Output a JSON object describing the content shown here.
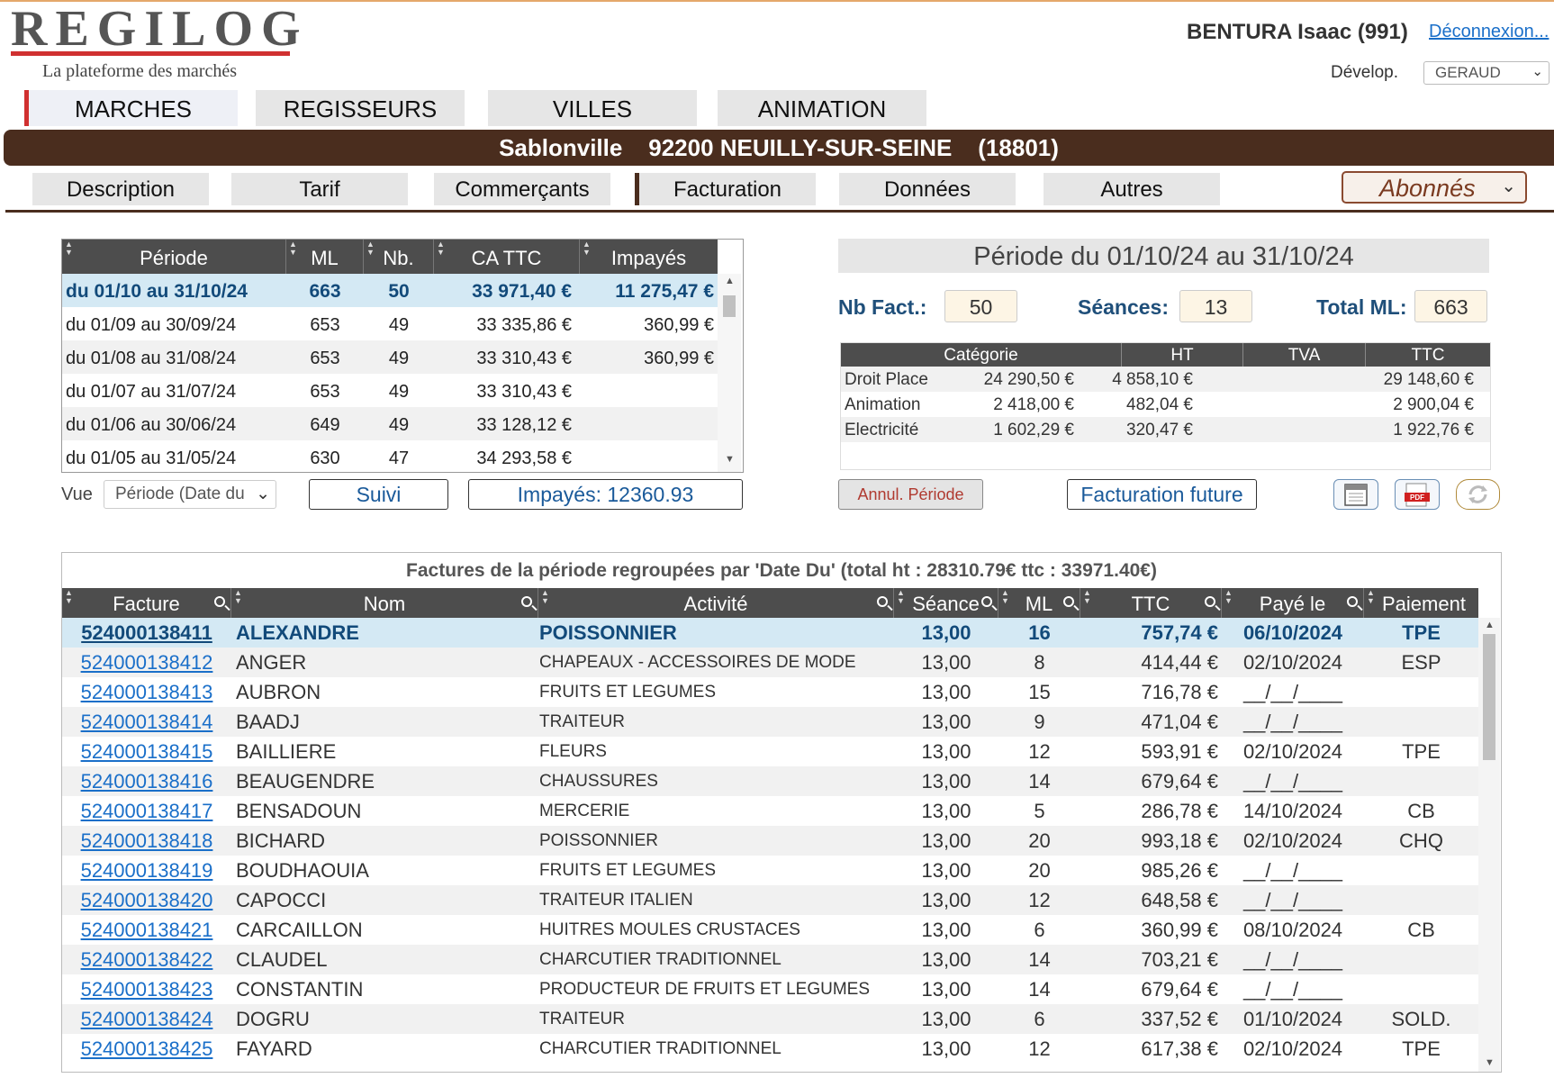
{
  "header": {
    "logo_text": "REGILOG",
    "logo_subtitle": "La plateforme des marchés",
    "user": "BENTURA Isaac (991)",
    "logout": "Déconnexion...",
    "env_label": "Dévelop.",
    "env_value": "GERAUD"
  },
  "main_tabs": [
    "MARCHES",
    "REGISSEURS",
    "VILLES",
    "ANIMATION"
  ],
  "location": "Sablonville    92200 NEUILLY-SUR-SEINE    (18801)",
  "sub_tabs": [
    "Description",
    "Tarif",
    "Commerçants",
    "Facturation",
    "Données",
    "Autres"
  ],
  "abonnes": "Abonnés",
  "periods": {
    "headers": [
      "Période",
      "ML",
      "Nb.",
      "CA TTC",
      "Impayés"
    ],
    "rows": [
      {
        "periode": "du 01/10 au 31/10/24",
        "ml": "663",
        "nb": "50",
        "ca": "33 971,40 €",
        "impayes": "11 275,47 €"
      },
      {
        "periode": "du 01/09 au 30/09/24",
        "ml": "653",
        "nb": "49",
        "ca": "33 335,86 €",
        "impayes": "360,99 €"
      },
      {
        "periode": "du 01/08 au 31/08/24",
        "ml": "653",
        "nb": "49",
        "ca": "33 310,43 €",
        "impayes": "360,99 €"
      },
      {
        "periode": "du 01/07 au 31/07/24",
        "ml": "653",
        "nb": "49",
        "ca": "33 310,43 €",
        "impayes": ""
      },
      {
        "periode": "du 01/06 au 30/06/24",
        "ml": "649",
        "nb": "49",
        "ca": "33 128,12 €",
        "impayes": ""
      },
      {
        "periode": "du 01/05 au 31/05/24",
        "ml": "630",
        "nb": "47",
        "ca": "34 293,58 €",
        "impayes": ""
      }
    ]
  },
  "controls": {
    "vue_label": "Vue",
    "vue_value": "Période (Date du",
    "suivi": "Suivi",
    "impayes": "Impayés: 12360.93"
  },
  "summary": {
    "title": "Période du 01/10/24 au 31/10/24",
    "nb_fact_label": "Nb Fact.:",
    "nb_fact": "50",
    "seances_label": "Séances:",
    "seances": "13",
    "total_ml_label": "Total ML:",
    "total_ml": "663",
    "cat_headers": [
      "Catégorie",
      "HT",
      "TVA",
      "TTC"
    ],
    "categories": [
      {
        "name": "Droit Place",
        "ht": "24 290,50 €",
        "tva": "4 858,10 €",
        "ttc": "29 148,60 €"
      },
      {
        "name": "Animation",
        "ht": "2 418,00 €",
        "tva": "482,04 €",
        "ttc": "2 900,04 €"
      },
      {
        "name": "Electricité",
        "ht": "1 602,29 €",
        "tva": "320,47 €",
        "ttc": "1 922,76 €"
      }
    ],
    "annul": "Annul. Période",
    "future": "Facturation future",
    "pdf_label": "PDF"
  },
  "invoices": {
    "caption": "Factures de la période regroupées par 'Date Du' (total ht : 28310.79€ ttc : 33971.40€)",
    "headers": [
      "Facture",
      "Nom",
      "Activité",
      "Séance",
      "ML",
      "TTC",
      "Payé le",
      "Paiement"
    ],
    "rows": [
      {
        "facture": "524000138411",
        "nom": "ALEXANDRE",
        "activite": "POISSONNIER",
        "seance": "13,00",
        "ml": "16",
        "ttc": "757,74 €",
        "paye": "06/10/2024",
        "paiement": "TPE"
      },
      {
        "facture": "524000138412",
        "nom": "ANGER",
        "activite": "CHAPEAUX - ACCESSOIRES DE MODE",
        "seance": "13,00",
        "ml": "8",
        "ttc": "414,44 €",
        "paye": "02/10/2024",
        "paiement": "ESP"
      },
      {
        "facture": "524000138413",
        "nom": "AUBRON",
        "activite": "FRUITS ET LEGUMES",
        "seance": "13,00",
        "ml": "15",
        "ttc": "716,78 €",
        "paye": "__/__/____",
        "paiement": ""
      },
      {
        "facture": "524000138414",
        "nom": "BAADJ",
        "activite": "TRAITEUR",
        "seance": "13,00",
        "ml": "9",
        "ttc": "471,04 €",
        "paye": "__/__/____",
        "paiement": ""
      },
      {
        "facture": "524000138415",
        "nom": "BAILLIERE",
        "activite": "FLEURS",
        "seance": "13,00",
        "ml": "12",
        "ttc": "593,91 €",
        "paye": "02/10/2024",
        "paiement": "TPE"
      },
      {
        "facture": "524000138416",
        "nom": "BEAUGENDRE",
        "activite": "CHAUSSURES",
        "seance": "13,00",
        "ml": "14",
        "ttc": "679,64 €",
        "paye": "__/__/____",
        "paiement": ""
      },
      {
        "facture": "524000138417",
        "nom": "BENSADOUN",
        "activite": "MERCERIE",
        "seance": "13,00",
        "ml": "5",
        "ttc": "286,78 €",
        "paye": "14/10/2024",
        "paiement": "CB"
      },
      {
        "facture": "524000138418",
        "nom": "BICHARD",
        "activite": "POISSONNIER",
        "seance": "13,00",
        "ml": "20",
        "ttc": "993,18 €",
        "paye": "02/10/2024",
        "paiement": "CHQ"
      },
      {
        "facture": "524000138419",
        "nom": "BOUDHAOUIA",
        "activite": "FRUITS ET LEGUMES",
        "seance": "13,00",
        "ml": "20",
        "ttc": "985,26 €",
        "paye": "__/__/____",
        "paiement": ""
      },
      {
        "facture": "524000138420",
        "nom": "CAPOCCI",
        "activite": "TRAITEUR ITALIEN",
        "seance": "13,00",
        "ml": "12",
        "ttc": "648,58 €",
        "paye": "__/__/____",
        "paiement": ""
      },
      {
        "facture": "524000138421",
        "nom": "CARCAILLON",
        "activite": "HUITRES MOULES CRUSTACES",
        "seance": "13,00",
        "ml": "6",
        "ttc": "360,99 €",
        "paye": "08/10/2024",
        "paiement": "CB"
      },
      {
        "facture": "524000138422",
        "nom": "CLAUDEL",
        "activite": "CHARCUTIER TRADITIONNEL",
        "seance": "13,00",
        "ml": "14",
        "ttc": "703,21 €",
        "paye": "__/__/____",
        "paiement": ""
      },
      {
        "facture": "524000138423",
        "nom": "CONSTANTIN",
        "activite": "PRODUCTEUR DE FRUITS ET LEGUMES",
        "seance": "13,00",
        "ml": "14",
        "ttc": "679,64 €",
        "paye": "__/__/____",
        "paiement": ""
      },
      {
        "facture": "524000138424",
        "nom": "DOGRU",
        "activite": "TRAITEUR",
        "seance": "13,00",
        "ml": "6",
        "ttc": "337,52 €",
        "paye": "01/10/2024",
        "paiement": "SOLD."
      },
      {
        "facture": "524000138425",
        "nom": "FAYARD",
        "activite": "CHARCUTIER TRADITIONNEL",
        "seance": "13,00",
        "ml": "12",
        "ttc": "617,38 €",
        "paye": "02/10/2024",
        "paiement": "TPE"
      }
    ]
  }
}
